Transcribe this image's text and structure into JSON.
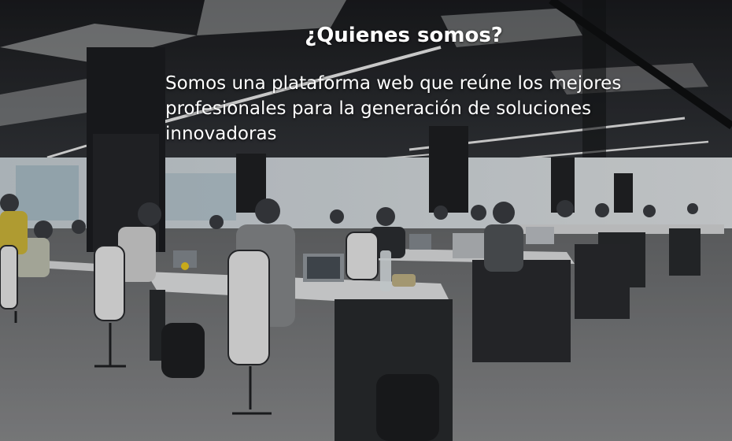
{
  "hero": {
    "title": "¿Quienes somos?",
    "description": "Somos una plataforma web que reúne los mejores profesionales para la generación de soluciones innovadoras"
  }
}
